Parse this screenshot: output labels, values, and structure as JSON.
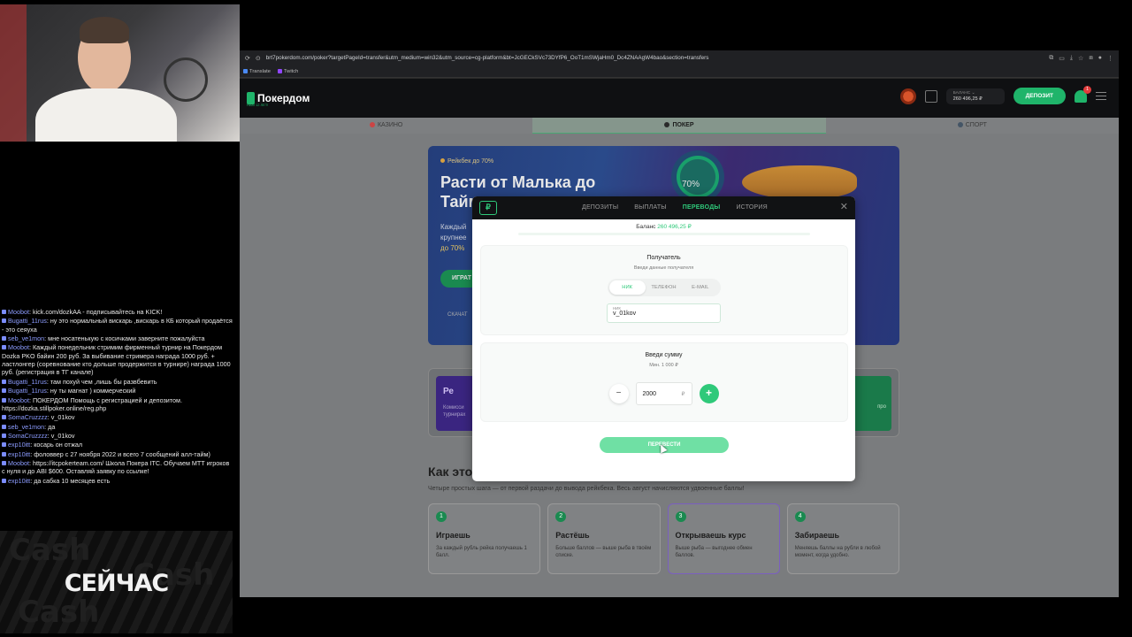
{
  "browser": {
    "url": "brt7pokerdom.com/poker?targetPageId=transfer&utm_medium=win32&utm_source=cg-platform&bt=JcGECkSVc73DYfP6_OoT1mSWjaHm0_Dc4ZNAAgW4bao&section=transfers",
    "bookmarks": [
      "Translate",
      "Twitch"
    ]
  },
  "site": {
    "logo": "Покердом",
    "logo_sub": "НАМ 12 ЛЕТ!",
    "balance_label": "БАЛАНС ⌄",
    "balance_value": "260 496,25 ₽",
    "deposit_label": "ДЕПОЗИТ",
    "notif_count": "1",
    "categories": [
      "КАЗИНО",
      "ПОКЕР",
      "СПОРТ"
    ],
    "promo": {
      "badge": "Рейкбек до 70%",
      "title": "Расти от Малька до Тайм",
      "desc_1": "Каждый",
      "desc_2": "крупнее",
      "desc_3": "до 70%",
      "play": "ИГРАТ",
      "download": "СКАЧАТ",
      "ring_value": "70%"
    },
    "card_left_title": "Ре",
    "card_left_desc": "Комисси турнирах",
    "card_right_desc": "про",
    "how_title": "Как это",
    "how_sub": "Четыре простых шага — от первой раздачи до вывода рейкбека. Весь август начисляются удвоенные баллы!",
    "steps": [
      {
        "num": "1",
        "title": "Играешь",
        "desc": "За каждый рубль рейка получаешь 1 балл."
      },
      {
        "num": "2",
        "title": "Растёшь",
        "desc": "Больше баллов — выше рыба в твоём списке."
      },
      {
        "num": "3",
        "title": "Открываешь курс",
        "desc": "Выше рыба — выгоднее обмен баллов."
      },
      {
        "num": "4",
        "title": "Забираешь",
        "desc": "Меняешь баллы на рубли в любой момент, когда удобно."
      }
    ]
  },
  "modal": {
    "logo": "₽",
    "tabs": [
      "ДЕПОЗИТЫ",
      "ВЫПЛАТЫ",
      "ПЕРЕВОДЫ",
      "ИСТОРИЯ"
    ],
    "active_tab": "ПЕРЕВОДЫ",
    "close": "✕",
    "balance_label": "Баланс",
    "balance_value": "260 496,25 ₽",
    "recipient_title": "Получатель",
    "recipient_sub": "Введи данные получателя",
    "recipient_options": [
      "НИК",
      "ТЕЛЕФОН",
      "E-MAIL"
    ],
    "nick_label": "НИК",
    "nick_value": "v_01kov",
    "amount_title": "Введи сумму",
    "amount_min": "Мин. 1 000 ₽",
    "amount_value": "2000",
    "amount_currency": "₽",
    "minus": "−",
    "plus": "+",
    "send_label": "ПЕРЕВЕСТИ"
  },
  "chat": [
    {
      "user": "Moobot",
      "text": "kick.com/dozkAA - подписывайтесь на KICK!"
    },
    {
      "user": "Bugatti_11rus",
      "text": "ну это нормальный вискарь ,вискарь в КБ который продаётся - это сеяуха"
    },
    {
      "user": "seb_ve1mon",
      "text": "мне носатенькую с косичками заверните пожалуйста"
    },
    {
      "user": "Moobot",
      "text": "Каждый понедельник стримим фирменный турнир на Покердом Dozka PKO байин 200 руб. За выбивание стримера награда 1000 руб. + ластлонгер (соревнование кто дольше продержится в турнире) награда 1000 руб. (регистрация в ТГ канале)"
    },
    {
      "user": "Bugatti_11rus",
      "text": "там похуй чем ,лишь бы развбевить"
    },
    {
      "user": "Bugatti_11rus",
      "text": "ну ты магнат ) коммерческий"
    },
    {
      "user": "Moobot",
      "text": "ПОКЕРДОМ Помощь с регистрацией и депозитом. https://dozka.stillpoker.online/reg.php"
    },
    {
      "user": "SomaCruzzzz",
      "text": "v_01kov"
    },
    {
      "user": "seb_ve1mon",
      "text": "да"
    },
    {
      "user": "SomaCruzzzz",
      "text": "v_01kov"
    },
    {
      "user": "exp10itt",
      "text": "косарь он отжал"
    },
    {
      "user": "exp10itt",
      "text": "фоловвер с 27 ноября 2022 и всего 7 сообщений алл-тайм)"
    },
    {
      "user": "Moobot",
      "text": "https://itcpokerteam.com/ Школа Покера ITC. Обучаем МТТ игроков с нуля и до ABI $600. Оставляй заявку по ссылке!"
    },
    {
      "user": "exp10itt",
      "text": "да сабка 10 месяцев есть"
    }
  ],
  "overlay": {
    "now_label": "СЕЙЧАС",
    "bg_word": "Cash"
  }
}
